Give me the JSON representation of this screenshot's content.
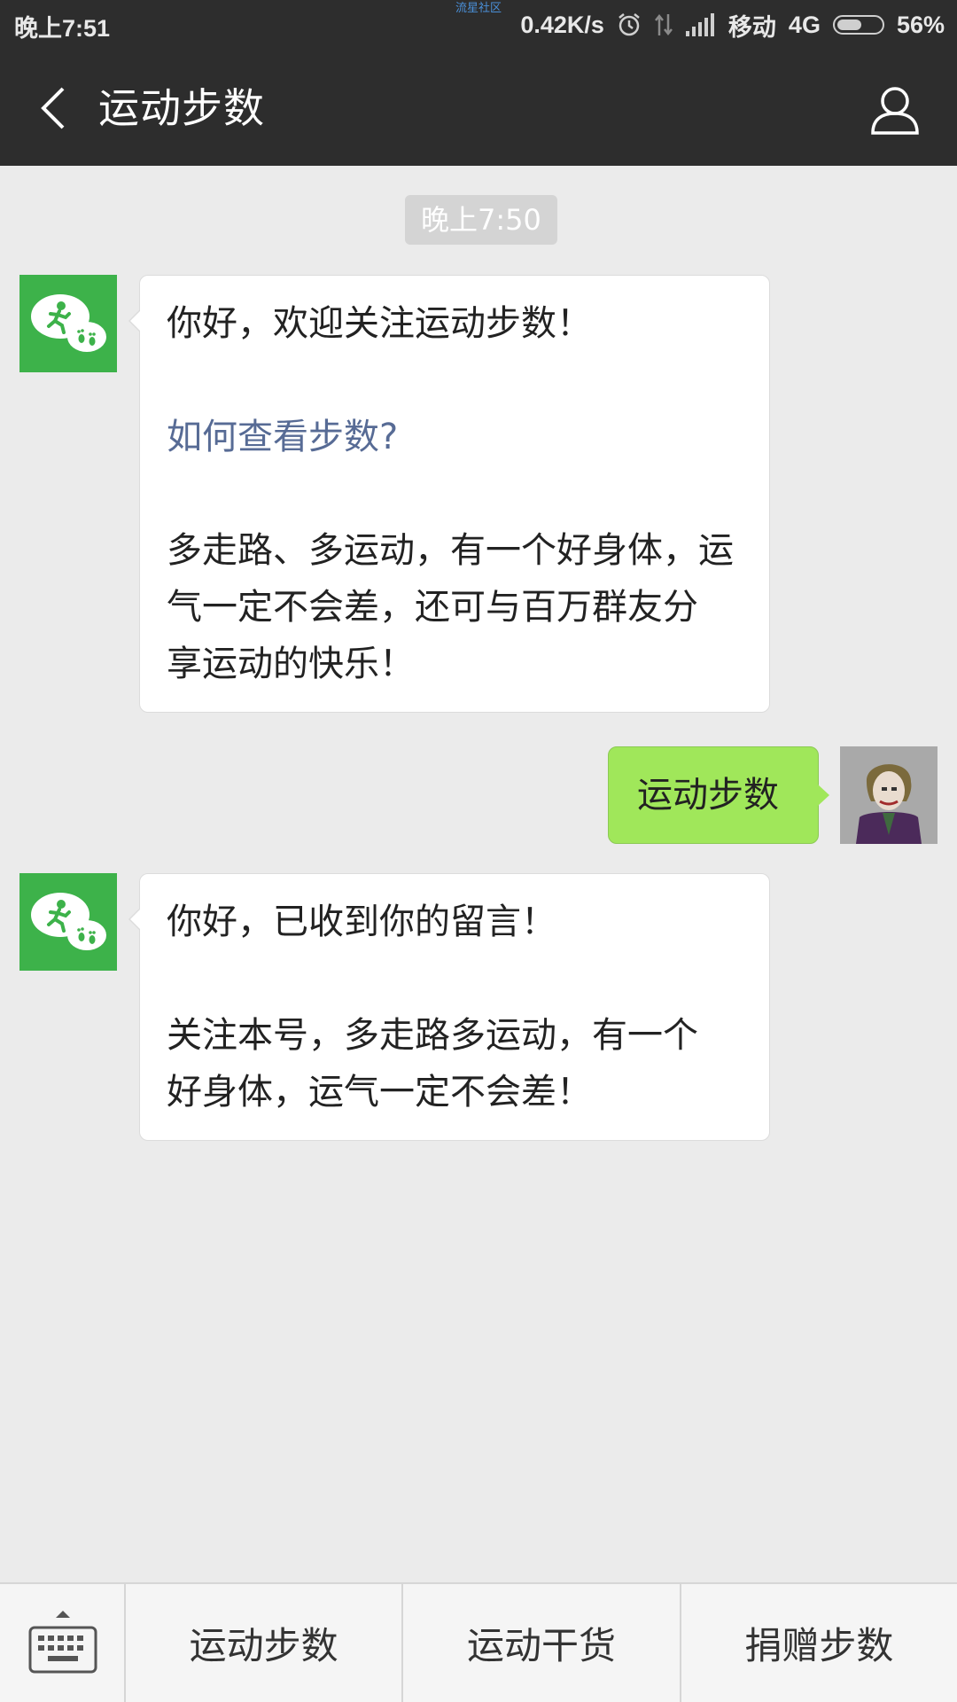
{
  "status_bar": {
    "time": "晚上7:51",
    "watermark": "流星社区",
    "net_speed": "0.42K/s",
    "carrier": "移动",
    "network": "4G",
    "battery": "56%",
    "battery_level": 0.56
  },
  "nav": {
    "title": "运动步数"
  },
  "chat": {
    "timestamp": "晚上7:50",
    "messages": [
      {
        "from": "bot",
        "lines": [
          "你好，欢迎关注运动步数！",
          "",
          "如何查看步数?",
          "",
          "多走路、多运动，有一个好身体，运",
          "气一定不会差，还可与百万群友分",
          "享运动的快乐！"
        ]
      },
      {
        "from": "user",
        "text": "运动步数"
      },
      {
        "from": "bot",
        "lines": [
          "你好，已收到你的留言！",
          "",
          "关注本号，多走路多运动，有一个",
          "好身体，运气一定不会差！"
        ]
      }
    ]
  },
  "bottom_menu": {
    "items": [
      "运动步数",
      "运动干货",
      "捐赠步数"
    ]
  },
  "icons": {
    "back": "back-arrow-icon",
    "profile": "profile-icon",
    "keyboard": "keyboard-icon",
    "alarm": "alarm-icon",
    "signal": "signal-icon"
  },
  "colors": {
    "header_bg": "#2d2d2d",
    "chat_bg": "#ebebeb",
    "outgoing_bubble": "#a0e75a",
    "link": "#576b95",
    "bot_avatar": "#3db24a"
  }
}
